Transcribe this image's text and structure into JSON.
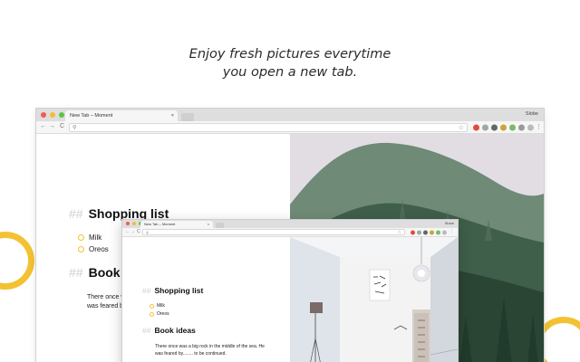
{
  "headline": {
    "line1": "Enjoy fresh pictures everytime",
    "line2": "you open a new tab."
  },
  "browser": {
    "tab_title": "New Tab – Moment",
    "tab_close": "×",
    "profile_name": "Slobe",
    "nav": {
      "back": "←",
      "forward": "→",
      "reload": "C"
    },
    "search_icon": "search-icon",
    "star_icon": "☆"
  },
  "notes": {
    "heading_marker": "##",
    "shopping_title": "Shopping list",
    "shopping_items": [
      "Milk",
      "Oreos"
    ],
    "book_title_big": "Book i",
    "book_title": "Book ideas",
    "book_text_big_1": "There once w",
    "book_text_big_2": "was feared b",
    "book_text_1": "There once was a big rock in the middle of the sea.  He",
    "book_text_2": "was feared by........ to be continued."
  },
  "colors": {
    "accent": "#f2c232",
    "tabbar": "#dedede",
    "toolbar": "#f6f6f6"
  }
}
